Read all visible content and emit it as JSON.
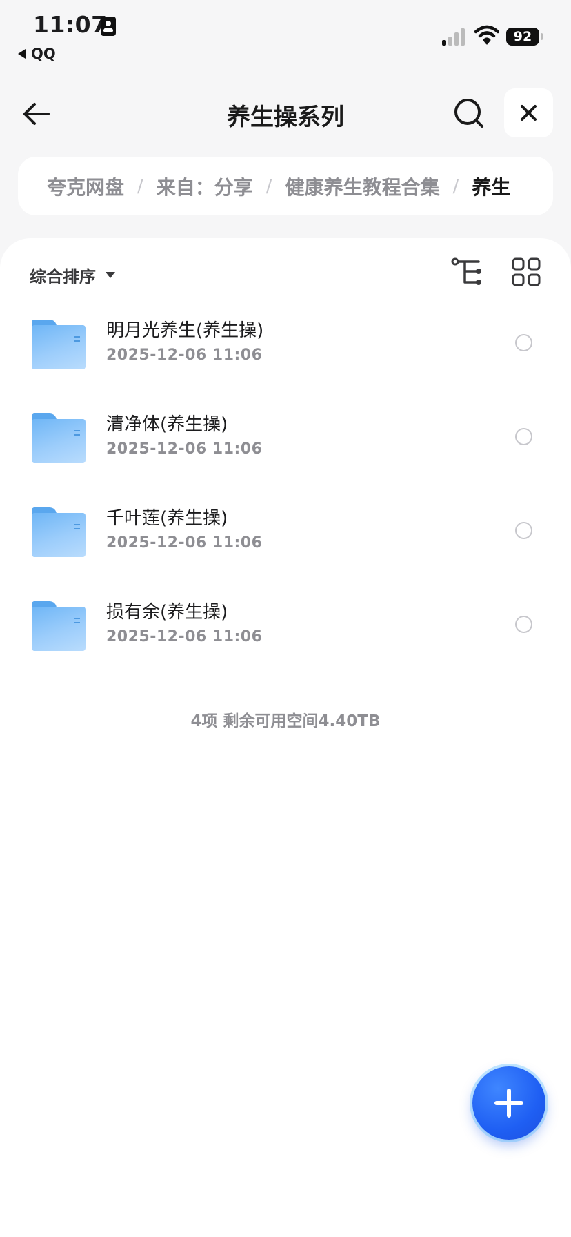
{
  "status_bar": {
    "time": "11:07",
    "back_app": "QQ",
    "battery": "92"
  },
  "header": {
    "title": "养生操系列"
  },
  "breadcrumb": [
    {
      "label": "夸克网盘"
    },
    {
      "label": "来自：分享"
    },
    {
      "label": "健康养生教程合集"
    },
    {
      "label": "养生"
    }
  ],
  "toolbar": {
    "sort_label": "综合排序"
  },
  "files": [
    {
      "name": "明月光养生(养生操)",
      "date": "2025-12-06 11:06"
    },
    {
      "name": "清净体(养生操)",
      "date": "2025-12-06 11:06"
    },
    {
      "name": "千叶莲(养生操)",
      "date": "2025-12-06 11:06"
    },
    {
      "name": "损有余(养生操)",
      "date": "2025-12-06 11:06"
    }
  ],
  "summary": "4项 剩余可用空间4.40TB",
  "icons": {
    "back": "back-arrow-icon",
    "search": "search-icon",
    "close": "close-icon",
    "tree": "tree-view-icon",
    "grid": "grid-view-icon",
    "add": "plus-icon",
    "folder": "folder-icon"
  },
  "colors": {
    "accent": "#1f5ff3",
    "folder": "#6fb6f6",
    "secondary_text": "#8e8e93"
  }
}
